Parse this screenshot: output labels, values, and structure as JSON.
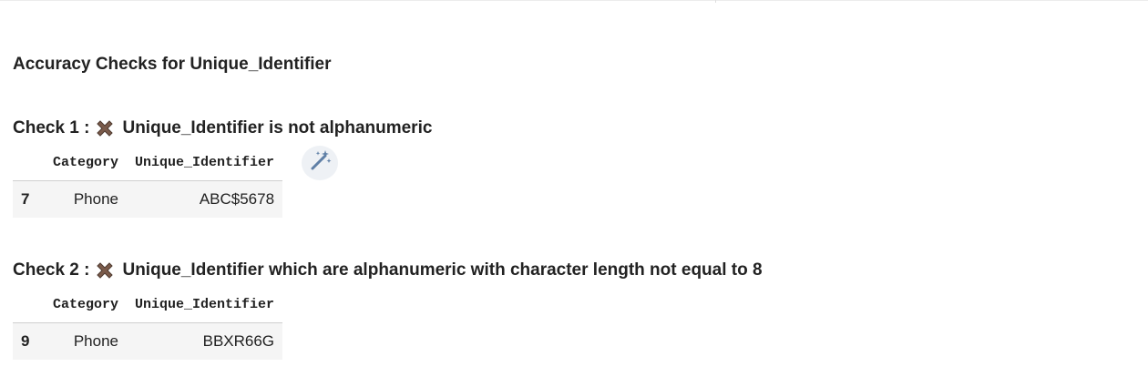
{
  "page": {
    "heading": "Accuracy Checks for Unique_Identifier"
  },
  "checks": [
    {
      "prefix": "Check 1 :",
      "status_icon": "cross-mark-icon",
      "description": "Unique_Identifier is not alphanumeric",
      "table": {
        "columns": [
          "Category",
          "Unique_Identifier"
        ],
        "rows": [
          {
            "index": "7",
            "Category": "Phone",
            "Unique_Identifier": "ABC$5678"
          }
        ]
      }
    },
    {
      "prefix": "Check 2 :",
      "status_icon": "cross-mark-icon",
      "description": "Unique_Identifier which are alphanumeric with character length not equal to 8",
      "table": {
        "columns": [
          "Category",
          "Unique_Identifier"
        ],
        "rows": [
          {
            "index": "9",
            "Category": "Phone",
            "Unique_Identifier": "BBXR66G"
          }
        ]
      }
    }
  ],
  "toolbar": {
    "magic_button_icon": "magic-wand-icon"
  },
  "colors": {
    "cross_mark": "#7a5a4a",
    "row_background": "#f5f5f5",
    "header_border": "#cfcfcf"
  }
}
